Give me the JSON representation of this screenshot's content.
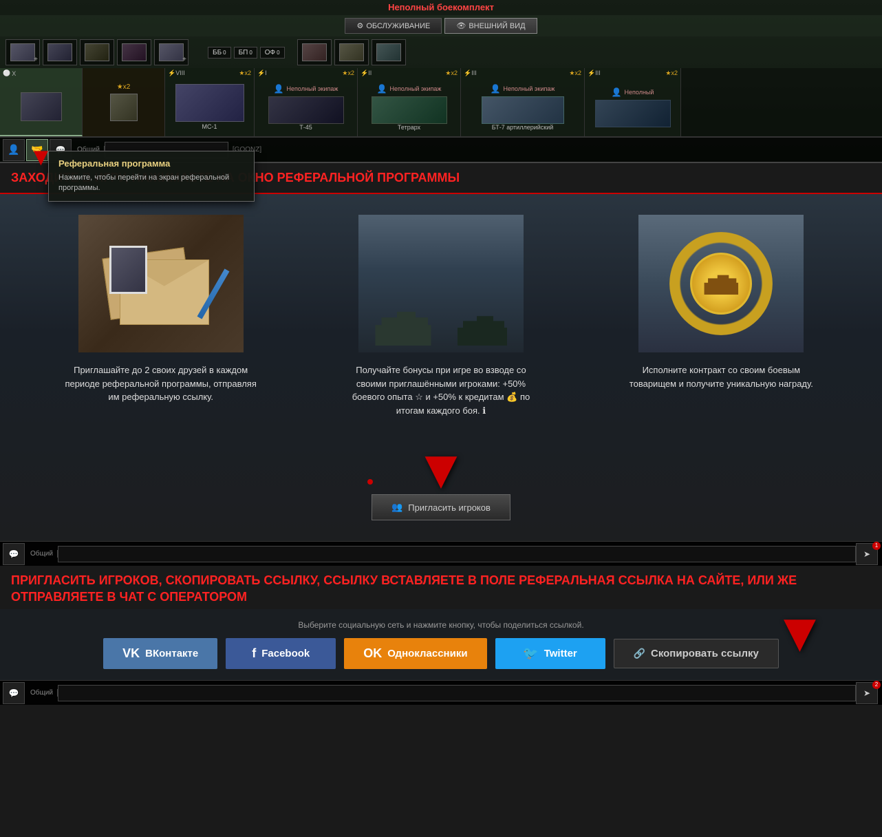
{
  "title": "Неполный боекомплект",
  "service_buttons": {
    "service": "ОБСЛУЖИВАНИЕ",
    "appearance": "ВНЕШНИЙ ВИД"
  },
  "tooltip": {
    "title": "Реферальная программа",
    "description": "Нажмите, чтобы перейти на экран реферальной программы."
  },
  "tanks": [
    {
      "tier": "X",
      "stars": "x2",
      "name": "",
      "active": true
    },
    {
      "tier": "VIII",
      "stars": "x2",
      "name": "МС-1"
    },
    {
      "tier": "I",
      "stars": "x2",
      "name": "Т-45",
      "crew": "Неполный экипаж"
    },
    {
      "tier": "II",
      "stars": "x2",
      "name": "Тетрарх",
      "crew": "Неполный экипаж"
    },
    {
      "tier": "III",
      "stars": "x2",
      "name": "БТ-7 артиллерийский",
      "crew": "Неполный экипаж"
    },
    {
      "tier": "III",
      "stars": "x2",
      "name": "Неполный",
      "crew": "Неполный экипаж"
    }
  ],
  "chat": {
    "channel": "Общий",
    "tag": "[GOONZ]"
  },
  "instruction1": "ЗАХОДИТЕ В ИГРУ, НАЖИМАЕТЕ НА ОКНО РЕФЕРАЛЬНОЙ ПРОГРАММЫ",
  "features": [
    {
      "desc": "Приглашайте до 2 своих друзей в каждом периоде реферальной программы, отправляя им реферальную ссылку."
    },
    {
      "desc": "Получайте бонусы при игре во взводе со своими приглашёнными игроками: +50% боевого опыта ☆  и +50% к кредитам 💰 по итогам каждого боя. ℹ"
    },
    {
      "desc": "Исполните контракт со своим боевым товарищем и получите уникальную награду."
    }
  ],
  "invite_button": "Пригласить игроков",
  "instruction2": "ПРИГЛАСИТЬ ИГРОКОВ, СКОПИРОВАТЬ ССЫЛКУ, ССЫЛКУ ВСТАВЛЯЕТЕ В ПОЛЕ РЕФЕРАЛЬНАЯ ССЫЛКА НА САЙТЕ, ИЛИ ЖЕ ОТПРАВЛЯЕТЕ В ЧАТ       С ОПЕРАТОРОМ",
  "share": {
    "label": "Выберите социальную сеть и нажмите кнопку, чтобы поделиться ссылкой.",
    "buttons": {
      "vk": "ВКонтакте",
      "fb": "Facebook",
      "ok": "Одноклассники",
      "tw": "Twitter",
      "copy": "Скопировать ссылку"
    }
  },
  "bottom_chat": {
    "channel": "Общий"
  },
  "notify_counts": {
    "send_btn": "1",
    "bottom_send_btn": "2"
  }
}
